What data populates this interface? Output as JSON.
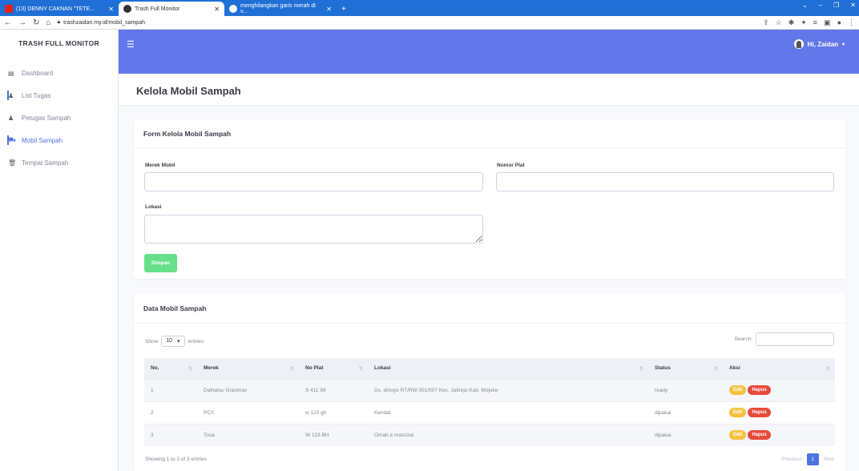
{
  "browser": {
    "tabs": [
      {
        "title": "(13) DENNY CAKNAN \"TETE..."
      },
      {
        "title": "Trash Full Monitor"
      },
      {
        "title": "menghilangkan garis merah di v..."
      }
    ],
    "url": "trashzaidan.my.id/mobil_sampah"
  },
  "sidebar": {
    "brand": "TRASH FULL MONITOR",
    "items": [
      {
        "label": "Dashboard",
        "icon": "dashboard-icon"
      },
      {
        "label": "List Tugas",
        "icon": "user-icon"
      },
      {
        "label": "Petugas Sampah",
        "icon": "user-icon"
      },
      {
        "label": "Mobil Sampah",
        "icon": "truck-icon"
      },
      {
        "label": "Tempat Sampah",
        "icon": "trash-icon"
      }
    ]
  },
  "topbar": {
    "user_label": "Hi, Zaidan"
  },
  "page": {
    "title": "Kelola Mobil Sampah"
  },
  "form": {
    "title": "Form Kelola Mobil Sampah",
    "merek_label": "Merek Mobil",
    "merek_value": "",
    "plat_label": "Nomor Plat",
    "plat_value": "",
    "lokasi_label": "Lokasi",
    "lokasi_value": "",
    "submit_label": "Simpan"
  },
  "table_card": {
    "title": "Data Mobil Sampah",
    "show_label": "Show",
    "entries_value": "10",
    "entries_label": "entries",
    "search_label": "Search:",
    "columns": [
      "No.",
      "Merek",
      "No Plat",
      "Lokasi",
      "Status",
      "Aksi"
    ],
    "rows": [
      {
        "no": "1",
        "merek": "Daihatsu Granmax",
        "plat": "S 411 IM",
        "lokasi": "Ds. dinoyo RT/RW 001/007 Kec. Jatirejo Kab. Mojoke",
        "status": "ready"
      },
      {
        "no": "2",
        "merek": "PCX",
        "plat": "w 123 gh",
        "lokasi": "Kendal",
        "status": "dipakai"
      },
      {
        "no": "3",
        "merek": "Tosa",
        "plat": "W 123 BH",
        "lokasi": "Omah e masrizal",
        "status": "dipakai"
      }
    ],
    "edit_label": "Edit",
    "hapus_label": "Hapus",
    "info": "Showing 1 to 3 of 3 entries",
    "prev_label": "Previous",
    "page_number": "1",
    "next_label": "Next"
  },
  "colors": {
    "topbar": "#6177ea",
    "accent": "#4e73df",
    "simpan": "#66e08a",
    "edit": "#f6c23e",
    "hapus": "#e74a3b"
  }
}
